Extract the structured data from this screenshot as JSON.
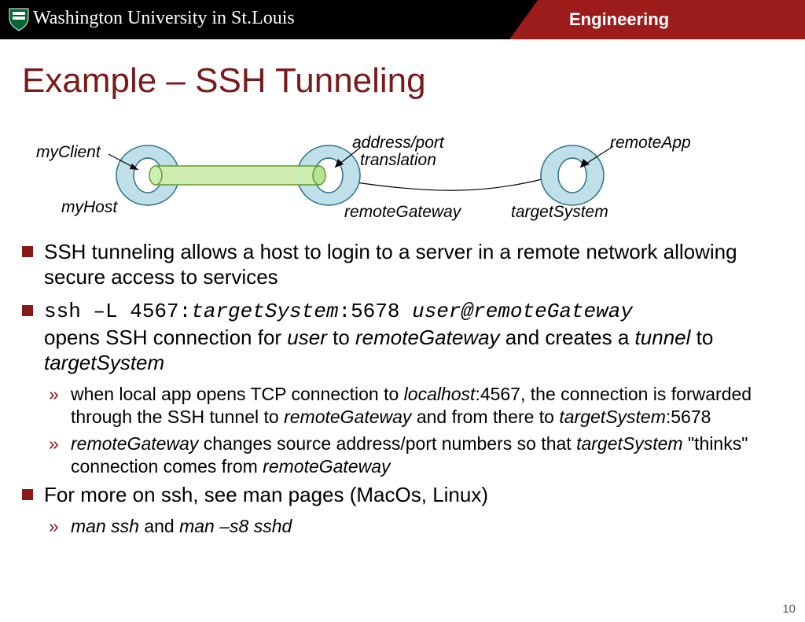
{
  "header": {
    "university": "Washington University in St.Louis",
    "engineering": "Engineering"
  },
  "title": "Example – SSH Tunneling",
  "diagram": {
    "myClient": "myClient",
    "myHost": "myHost",
    "addrPort1": "address/port",
    "addrPort2": "translation",
    "remoteGateway": "remoteGateway",
    "remoteApp": "remoteApp",
    "targetSystem": "targetSystem"
  },
  "bullets": {
    "p1": "SSH tunneling allows a host to login to a server in a remote  network allowing secure access to services",
    "p2_cmd": "ssh –L 4567:",
    "p2_ts": "targetSystem",
    "p2_mid": ":5678 ",
    "p2_ug": "user@remoteGateway",
    "p2_tail_a": "opens SSH connection for ",
    "p2_user": "user",
    "p2_tail_b": " to ",
    "p2_rg": "remoteGateway",
    "p2_tail_c": " and creates a ",
    "p2_tunnel": "tunnel",
    "p2_tail_d": " to ",
    "p2_ts2": "targetSystem",
    "p2s1_a": "when local app opens TCP connection to ",
    "p2s1_lh": "localhost",
    "p2s1_b": ":4567, the connection is forwarded through the SSH tunnel to ",
    "p2s1_rg": "remoteGateway",
    "p2s1_c": " and from there to ",
    "p2s1_ts": "targetSystem",
    "p2s1_d": ":5678",
    "p2s2_rg": "remoteGateway",
    "p2s2_a": " changes source address/port numbers so that ",
    "p2s2_ts": "targetSystem",
    "p2s2_b": " \"thinks\" connection comes from ",
    "p2s2_rg2": "remoteGateway",
    "p3": "For more on ssh, see man pages (MacOs, Linux)",
    "p3s1_a": "man ssh",
    "p3s1_b": " and ",
    "p3s1_c": "man –s8 sshd"
  },
  "pageNumber": "10"
}
